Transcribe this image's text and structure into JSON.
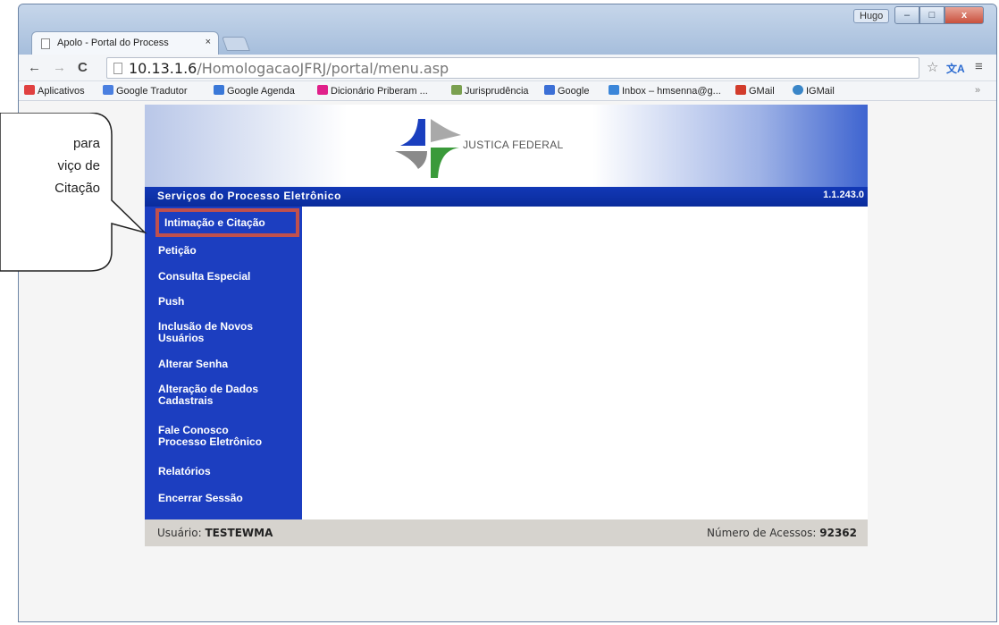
{
  "browser": {
    "tab_title": "Apolo - Portal do Process",
    "tab_close": "×",
    "profile_name": "Hugo",
    "window_buttons": {
      "minimize": "–",
      "maximize": "□",
      "close": "x"
    },
    "url_host": "10.13.1.6",
    "url_path": "/HomologacaoJFRJ/portal/menu.asp",
    "nav": {
      "back": "←",
      "forward": "→",
      "reload": "C"
    },
    "toolbar_icons": {
      "star": "☆",
      "translate": "文A",
      "menu": "≡"
    },
    "bookmarks": [
      {
        "label": "Aplicativos",
        "icon_color": "#e04040"
      },
      {
        "label": "Google Tradutor",
        "icon_color": "#4a7fe0"
      },
      {
        "label": "Google Agenda",
        "icon_color": "#3a78d8"
      },
      {
        "label": "Dicionário Priberam ...",
        "icon_color": "#e0208a"
      },
      {
        "label": "Jurisprudência",
        "icon_color": "#7aa050"
      },
      {
        "label": "Google",
        "icon_color": "#3b6fd6"
      },
      {
        "label": "Inbox – hmsenna@g...",
        "icon_color": "#3b86d9"
      },
      {
        "label": "GMail",
        "icon_color": "#d23c2c"
      },
      {
        "label": "IGMail",
        "icon_color": "#3a86c8"
      }
    ],
    "bookmarks_overflow": "»"
  },
  "portal": {
    "logo_text": "JUSTICA FEDERAL",
    "services_title": "Serviços do Processo Eletrônico",
    "version": "1.1.243.0",
    "menu": [
      {
        "lines": [
          "Intimação e Citação"
        ]
      },
      {
        "lines": [
          "Petição"
        ]
      },
      {
        "lines": [
          "Consulta Especial"
        ]
      },
      {
        "lines": [
          "Push"
        ]
      },
      {
        "lines": [
          "Inclusão de Novos",
          "Usuários"
        ]
      },
      {
        "lines": [
          "Alterar Senha"
        ]
      },
      {
        "lines": [
          "Alteração de Dados",
          "Cadastrais"
        ]
      },
      {
        "lines": [
          "Fale Conosco",
          "Processo Eletrônico"
        ]
      },
      {
        "lines": [
          "Relatórios"
        ]
      },
      {
        "lines": [
          "Encerrar Sessão"
        ]
      }
    ],
    "footer": {
      "user_label": "Usuário:",
      "user_value": "TESTEWMA",
      "access_label": "Número de Acessos:",
      "access_value": "92362"
    }
  },
  "callout": {
    "lines": [
      "para",
      "viço de",
      "Citação"
    ]
  },
  "colors": {
    "menu_bg": "#1c3ec0",
    "services_bar": "#0a2c9c",
    "highlight_border": "#c0504d",
    "footer_bg": "#d6d3ce",
    "logo_blue": "#1a3fbf",
    "logo_green": "#3a9a3a",
    "logo_gray": "#8a8a8a"
  }
}
